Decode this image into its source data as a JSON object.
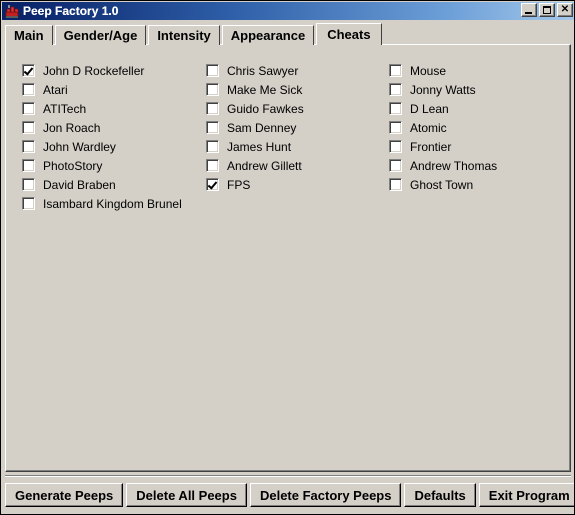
{
  "window": {
    "title": "Peep Factory 1.0",
    "icon": "factory-icon",
    "controls": {
      "minimize": "minimize-icon",
      "maximize": "maximize-icon",
      "close": "close-icon",
      "close_glyph": "✕"
    },
    "colors": {
      "titlebar_start": "#0a246a",
      "titlebar_end": "#a6c8ea",
      "face": "#d4d0c8",
      "text": "#000000",
      "field": "#ffffff"
    }
  },
  "tabs": [
    {
      "label": "Main",
      "selected": false
    },
    {
      "label": "Gender/Age",
      "selected": false
    },
    {
      "label": "Intensity",
      "selected": false
    },
    {
      "label": "Appearance",
      "selected": false
    },
    {
      "label": "Cheats",
      "selected": true
    }
  ],
  "cheats": {
    "columns": [
      {
        "items": [
          {
            "label": "John D Rockefeller",
            "checked": true
          },
          {
            "label": "Atari",
            "checked": false
          },
          {
            "label": "ATITech",
            "checked": false
          },
          {
            "label": "Jon Roach",
            "checked": false
          },
          {
            "label": "John Wardley",
            "checked": false
          },
          {
            "label": "PhotoStory",
            "checked": false
          },
          {
            "label": "David Braben",
            "checked": false
          },
          {
            "label": "Isambard Kingdom Brunel",
            "checked": false
          }
        ]
      },
      {
        "items": [
          {
            "label": "Chris Sawyer",
            "checked": false
          },
          {
            "label": "Make Me Sick",
            "checked": false
          },
          {
            "label": "Guido Fawkes",
            "checked": false
          },
          {
            "label": "Sam Denney",
            "checked": false
          },
          {
            "label": "James Hunt",
            "checked": false
          },
          {
            "label": "Andrew Gillett",
            "checked": false
          },
          {
            "label": "FPS",
            "checked": true
          }
        ]
      },
      {
        "items": [
          {
            "label": "Mouse",
            "checked": false
          },
          {
            "label": "Jonny Watts",
            "checked": false
          },
          {
            "label": "D Lean",
            "checked": false
          },
          {
            "label": "Atomic",
            "checked": false
          },
          {
            "label": "Frontier",
            "checked": false
          },
          {
            "label": "Andrew Thomas",
            "checked": false
          },
          {
            "label": "Ghost Town",
            "checked": false
          }
        ]
      }
    ]
  },
  "buttons": [
    {
      "label": "Generate Peeps",
      "name": "generate-peeps-button"
    },
    {
      "label": "Delete All Peeps",
      "name": "delete-all-peeps-button"
    },
    {
      "label": "Delete Factory Peeps",
      "name": "delete-factory-peeps-button"
    },
    {
      "label": "Defaults",
      "name": "defaults-button"
    },
    {
      "label": "Exit Program",
      "name": "exit-program-button"
    }
  ]
}
